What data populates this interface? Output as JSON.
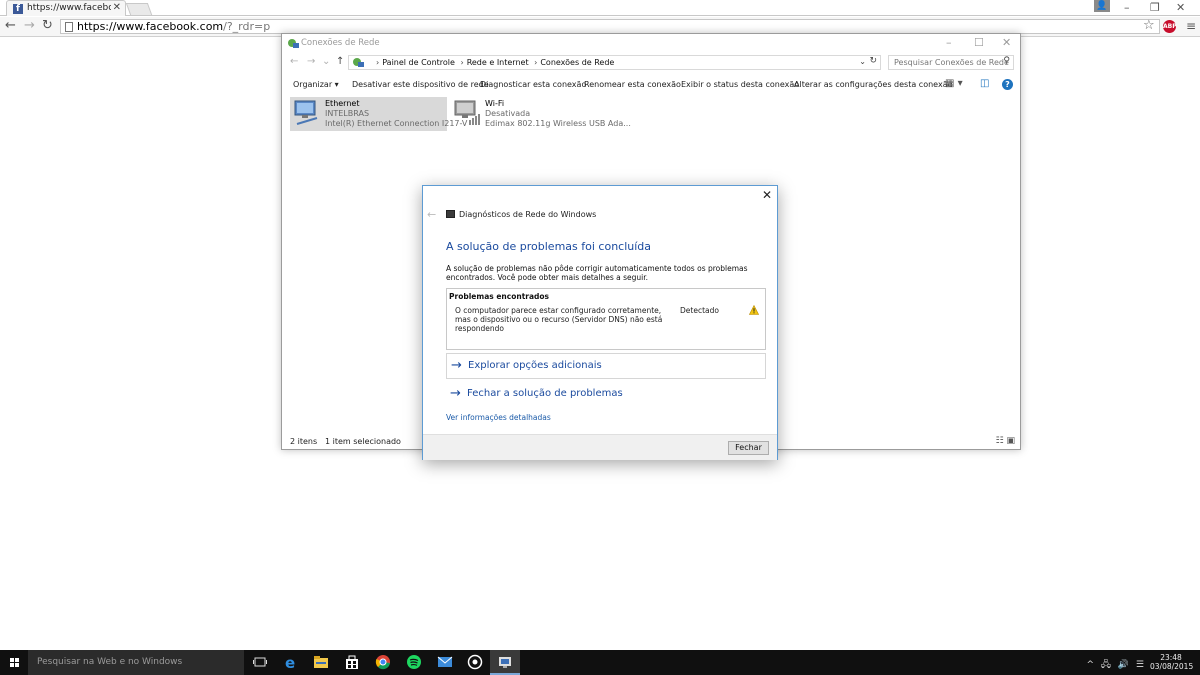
{
  "browser": {
    "tab_title": "https://www.facebook.com/",
    "tab_favicon_letter": "f",
    "address_host": "https://www.facebook.com",
    "address_path": "/?_rdr=p",
    "abp_label": "ABP"
  },
  "explorer": {
    "window_title": "Conexões de Rede",
    "breadcrumbs": [
      "Painel de Controle",
      "Rede e Internet",
      "Conexões de Rede"
    ],
    "search_placeholder": "Pesquisar Conexões de Rede",
    "commands": [
      "Organizar ▾",
      "Desativar este dispositivo de rede",
      "Diagnosticar esta conexão",
      "Renomear esta conexão",
      "Exibir o status desta conexão",
      "Alterar as configurações desta conexão"
    ],
    "help_label": "?",
    "connections": [
      {
        "name": "Ethernet",
        "network": "INTELBRAS",
        "device": "Intel(R) Ethernet Connection I217-V"
      },
      {
        "name": "Wi-Fi",
        "network": "Desativada",
        "device": "Edimax 802.11g Wireless USB Ada..."
      }
    ],
    "status_count": "2 itens",
    "status_selected": "1 item selecionado"
  },
  "dialog": {
    "app_title": "Diagnósticos de Rede do Windows",
    "heading": "A solução de problemas foi concluída",
    "description": "A solução de problemas não pôde corrigir automaticamente todos os problemas encontrados. Você pode obter mais detalhes a seguir.",
    "problems_header": "Problemas encontrados",
    "problem_text": "O computador parece estar configurado corretamente, mas o dispositivo ou o recurso (Servidor DNS) não está respondendo",
    "problem_status": "Detectado",
    "option_explore": "Explorar opções adicionais",
    "option_close": "Fechar a solução de problemas",
    "details_link": "Ver informações detalhadas",
    "close_button": "Fechar"
  },
  "taskbar": {
    "search_placeholder": "Pesquisar na Web e no Windows",
    "time": "23:48",
    "date": "03/08/2015"
  },
  "colors": {
    "accent_blue": "#1a4a9e",
    "taskbar": "#101010",
    "selection": "#d9d9d9"
  }
}
